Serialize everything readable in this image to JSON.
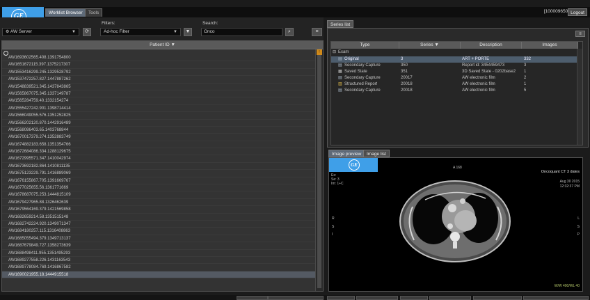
{
  "header": {
    "tabs": [
      {
        "label": "Worklist Browser"
      },
      {
        "label": "Tools"
      }
    ],
    "user": "[100009650]",
    "logout_label": "Logout",
    "logo_text": "GE"
  },
  "filters": {
    "source_select": "AW Server",
    "filters_label": "Filters:",
    "filter_select": "Ad-hoc Filter",
    "search_label": "Search:",
    "search_value": "Onco"
  },
  "patient_list": {
    "column_header": "Patient ID ▼",
    "rows": [
      "AW1693602565.408.1391754800",
      "AW1651672115.397.1375217307",
      "AW1553416299.245.1329528792",
      "AW1537472257.827.1447887262",
      "AW1548839521.345.1437843865",
      "AW1565867075.345.1337149787",
      "AW1565284759.40.1332154274",
      "AW1555427242.901.1398714414",
      "AW1566049055.576.1351252825",
      "AW1566202120.870.1442916489",
      "AW1568086403.65.1403768844",
      "AW1670017379.274.1352883749",
      "AW1674882183.658.1351354766",
      "AW1672684086.334.1288129675",
      "AW1672995571.347.1410042974",
      "AW1673692182.864.1410811135",
      "AW1675123229.791.1416889069",
      "AW1676155867.705.1391669767",
      "AW1677025655.56.1361771669",
      "AW1678687075.253.1444815109",
      "AW1679427965.88.1326462639",
      "AW1679564169.379.1421569858",
      "AW1682659214.58.1351515148",
      "AW1682742224.920.1349071347",
      "AW1684180257.115.1316408863",
      "AW1685055494.379.1349713137",
      "AW1687679849.727.1358273639",
      "AW1688498411.955.1351495293",
      "AW1689277558.226.1431163543",
      "AW1689778084.769.1416867582",
      "AW1690021955.18.1444915518"
    ],
    "selected_index": 30
  },
  "series_list": {
    "tab_label": "Series list",
    "columns": [
      "Type",
      "Series ▼",
      "Description",
      "Images"
    ],
    "group_label": "Exam",
    "rows": [
      {
        "type": "Original",
        "series": "3",
        "description": "ART + PORTE",
        "images": "332",
        "icon": "image-stack-icon",
        "selected": true
      },
      {
        "type": "Secondary Capture",
        "series": "350",
        "description": "Report id: 3454459473",
        "images": "3",
        "icon": "image-stack-icon"
      },
      {
        "type": "Saved State",
        "series": "351",
        "description": "3D Saved State - 0202base2",
        "images": "1",
        "icon": "saved-state-icon"
      },
      {
        "type": "Secondary Capture",
        "series": "20017",
        "description": "AW electronic film",
        "images": "2",
        "icon": "image-stack-icon"
      },
      {
        "type": "Structured Report",
        "series": "20018",
        "description": "AW electronic film",
        "images": "1",
        "icon": "report-icon"
      },
      {
        "type": "Secondary Capture",
        "series": "20018",
        "description": "AW electronic film",
        "images": "5",
        "icon": "image-stack-icon"
      }
    ]
  },
  "preview": {
    "tabs": [
      {
        "label": "Image preview"
      },
      {
        "label": "Image list"
      }
    ],
    "overlay": {
      "top_center": "A 168",
      "top_right_title": "Oncoquant CT 3 dates",
      "date": "Aug 30 2015",
      "time": "12:32:37 PM",
      "top_left": [
        "Ex:",
        "Se: 3",
        "Im: 1+C"
      ],
      "bottom_right": "W/W 400/WL 40",
      "left_letters": [
        "R",
        "",
        "S",
        "",
        "I"
      ],
      "right_letters": [
        "L",
        "",
        "S",
        "",
        "P"
      ]
    }
  }
}
